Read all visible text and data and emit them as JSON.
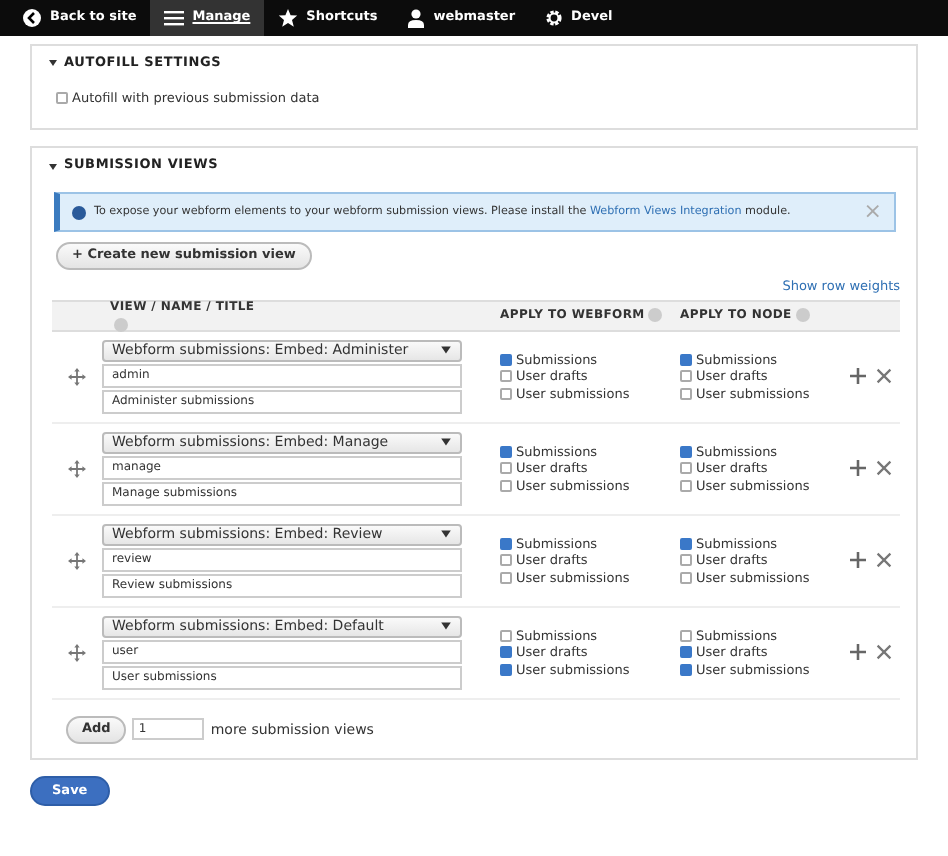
{
  "toolbar": [
    {
      "label": "Back to site",
      "selected": false
    },
    {
      "label": "Manage",
      "selected": true
    },
    {
      "label": "Shortcuts",
      "selected": false
    },
    {
      "label": "webmaster",
      "selected": false
    },
    {
      "label": "Devel",
      "selected": false
    }
  ],
  "autofill": {
    "title": "AUTOFILL SETTINGS",
    "expanded": true,
    "checkbox": {
      "label": "Autofill with previous submission data",
      "checked": false
    }
  },
  "submission_views": {
    "title": "SUBMISSION VIEWS",
    "expanded": true,
    "message": {
      "text": "To expose your webform elements to your webform submission views. Please install the ",
      "link": "Webform Views Integration",
      "after": " module.",
      "close": "×"
    },
    "create_button": "+ Create new submission view",
    "show_row_weights": "Show row weights",
    "columns": [
      "VIEW / NAME / TITLE",
      "APPLY TO WEBFORM",
      "APPLY TO NODE"
    ],
    "rows": [
      {
        "view": "Webform submissions: Embed: Administer",
        "name": "admin",
        "title": "Administer submissions",
        "webform": [
          {
            "label": "Submissions",
            "checked": true
          },
          {
            "label": "User drafts",
            "checked": false
          },
          {
            "label": "User submissions",
            "checked": false
          }
        ],
        "node": [
          {
            "label": "Submissions",
            "checked": true
          },
          {
            "label": "User drafts",
            "checked": false
          },
          {
            "label": "User submissions",
            "checked": false
          }
        ]
      },
      {
        "view": "Webform submissions: Embed: Manage",
        "name": "manage",
        "title": "Manage submissions",
        "webform": [
          {
            "label": "Submissions",
            "checked": true
          },
          {
            "label": "User drafts",
            "checked": false
          },
          {
            "label": "User submissions",
            "checked": false
          }
        ],
        "node": [
          {
            "label": "Submissions",
            "checked": true
          },
          {
            "label": "User drafts",
            "checked": false
          },
          {
            "label": "User submissions",
            "checked": false
          }
        ]
      },
      {
        "view": "Webform submissions: Embed: Review",
        "name": "review",
        "title": "Review submissions",
        "webform": [
          {
            "label": "Submissions",
            "checked": true
          },
          {
            "label": "User drafts",
            "checked": false
          },
          {
            "label": "User submissions",
            "checked": false
          }
        ],
        "node": [
          {
            "label": "Submissions",
            "checked": true
          },
          {
            "label": "User drafts",
            "checked": false
          },
          {
            "label": "User submissions",
            "checked": false
          }
        ]
      },
      {
        "view": "Webform submissions: Embed: Default",
        "name": "user",
        "title": "User submissions",
        "webform": [
          {
            "label": "Submissions",
            "checked": false
          },
          {
            "label": "User drafts",
            "checked": true
          },
          {
            "label": "User submissions",
            "checked": true
          }
        ],
        "node": [
          {
            "label": "Submissions",
            "checked": false
          },
          {
            "label": "User drafts",
            "checked": true
          },
          {
            "label": "User submissions",
            "checked": true
          }
        ]
      }
    ],
    "add": {
      "button": "Add",
      "value": "1",
      "suffix": "more submission views"
    }
  },
  "save_button": "Save"
}
